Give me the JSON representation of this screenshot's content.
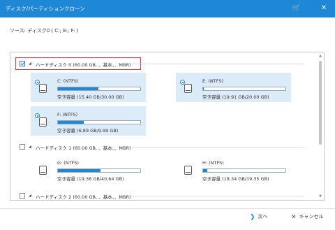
{
  "window": {
    "title": "ディスク/パーティションクローン",
    "controls": {
      "cart": "🛒",
      "close": "✕"
    }
  },
  "source": {
    "text": "ソース:  ディスク0 ( C:; E:; F: )"
  },
  "disks": [
    {
      "checked": true,
      "label": "ハードディスク 0 (60.00 GB, 、基本、、MBR)",
      "partitions": [
        {
          "name": "C: (NTFS)",
          "usage": "空き容量 (15.40 GB/30.00 GB)",
          "used_fraction": 0.49,
          "selected": true
        },
        {
          "name": "E: (NTFS)",
          "usage": "空き容量 (19.91 GB/20.00 GB)",
          "used_fraction": 0.005,
          "selected": true
        },
        {
          "name": "F: (NTFS)",
          "usage": "空き容量 (6.89 GB/9.99 GB)",
          "used_fraction": 0.31,
          "selected": true
        }
      ]
    },
    {
      "checked": false,
      "label": "ハードディスク 1 (60.00 GB, 、基本、、MBR)",
      "partitions": [
        {
          "name": "G: (NTFS)",
          "usage": "空き容量 (19.36 GB/40.64 GB)",
          "used_fraction": 0.52,
          "selected": false
        },
        {
          "name": "H: (NTFS)",
          "usage": "空き容量 (18.34 GB/19.35 GB)",
          "used_fraction": 0.05,
          "selected": false
        }
      ]
    },
    {
      "checked": false,
      "label": "ハードディスク 2 (60.00 GB, 、基本、、MBR)",
      "partitions": []
    }
  ],
  "footer": {
    "next_label": "次へ",
    "cancel_label": "キャンセル"
  },
  "colors": {
    "accent": "#1e88d6",
    "selected_bg": "#dcebf8",
    "highlight": "#e53935"
  }
}
